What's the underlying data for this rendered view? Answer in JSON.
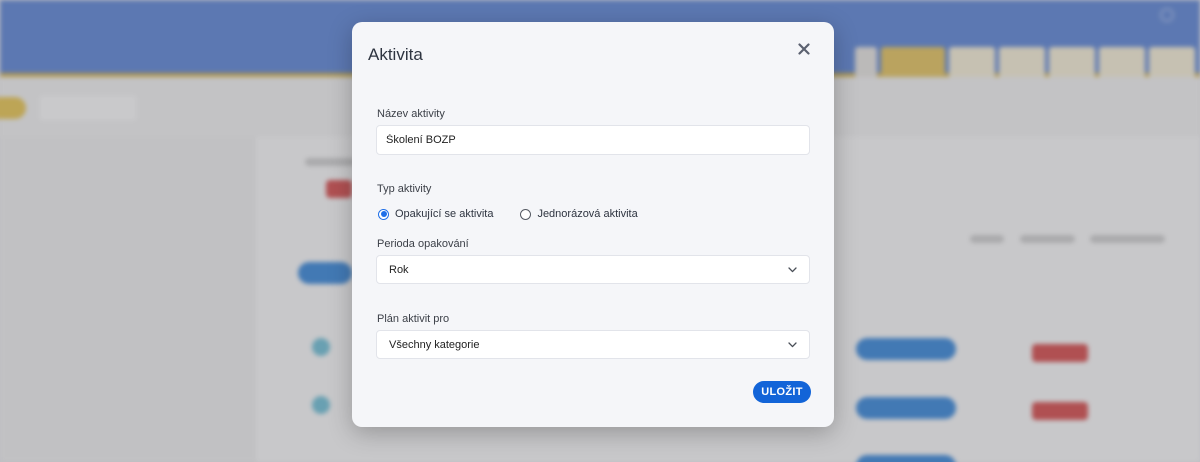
{
  "modal": {
    "title": "Aktivita",
    "close_icon": "close-icon"
  },
  "activity_name": {
    "label": "Název aktivity",
    "value": "Školení BOZP"
  },
  "activity_type": {
    "label": "Typ aktivity",
    "options": [
      {
        "label": "Opakující se aktivita",
        "selected": true
      },
      {
        "label": "Jednorázová aktivita",
        "selected": false
      }
    ]
  },
  "repeat_period": {
    "label": "Perioda opakování",
    "value": "Rok"
  },
  "plan_for": {
    "label": "Plán aktivit pro",
    "value": "Všechny kategorie"
  },
  "actions": {
    "save_label": "ULOŽIT"
  },
  "colors": {
    "accent": "#1264d8",
    "header": "#6b8fd6",
    "header_stripe": "#d8b85a"
  }
}
